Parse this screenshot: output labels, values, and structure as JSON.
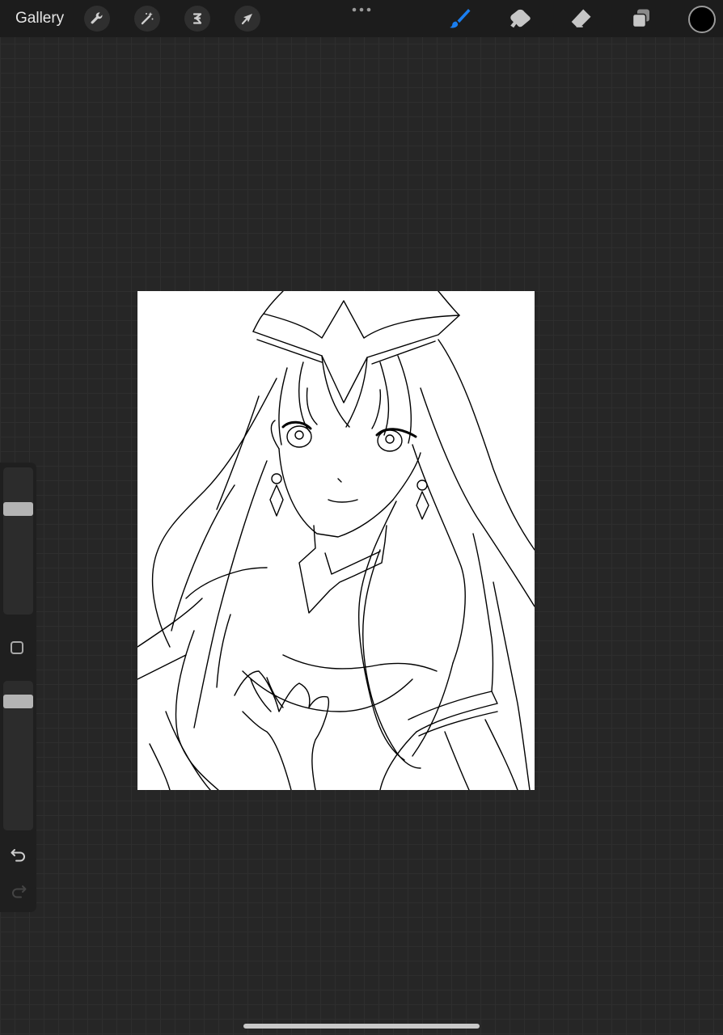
{
  "toolbar": {
    "gallery_label": "Gallery",
    "left_tools": [
      "wrench-icon",
      "magic-wand-icon",
      "selection-icon",
      "transform-arrow-icon"
    ],
    "more_menu": "ellipsis-icon",
    "right_tools": [
      "brush-icon",
      "smudge-icon",
      "eraser-icon",
      "layers-icon"
    ],
    "active_tool": "brush",
    "accent_color": "#1a7ef0",
    "current_color": "#000000"
  },
  "sidebar": {
    "brush_size_level": 0.19,
    "opacity_level": 0.11,
    "undo_icon": "undo-icon",
    "redo_icon": "redo-icon"
  },
  "canvas": {
    "background": "#ffffff",
    "artwork": "anime-girl-line-art"
  }
}
